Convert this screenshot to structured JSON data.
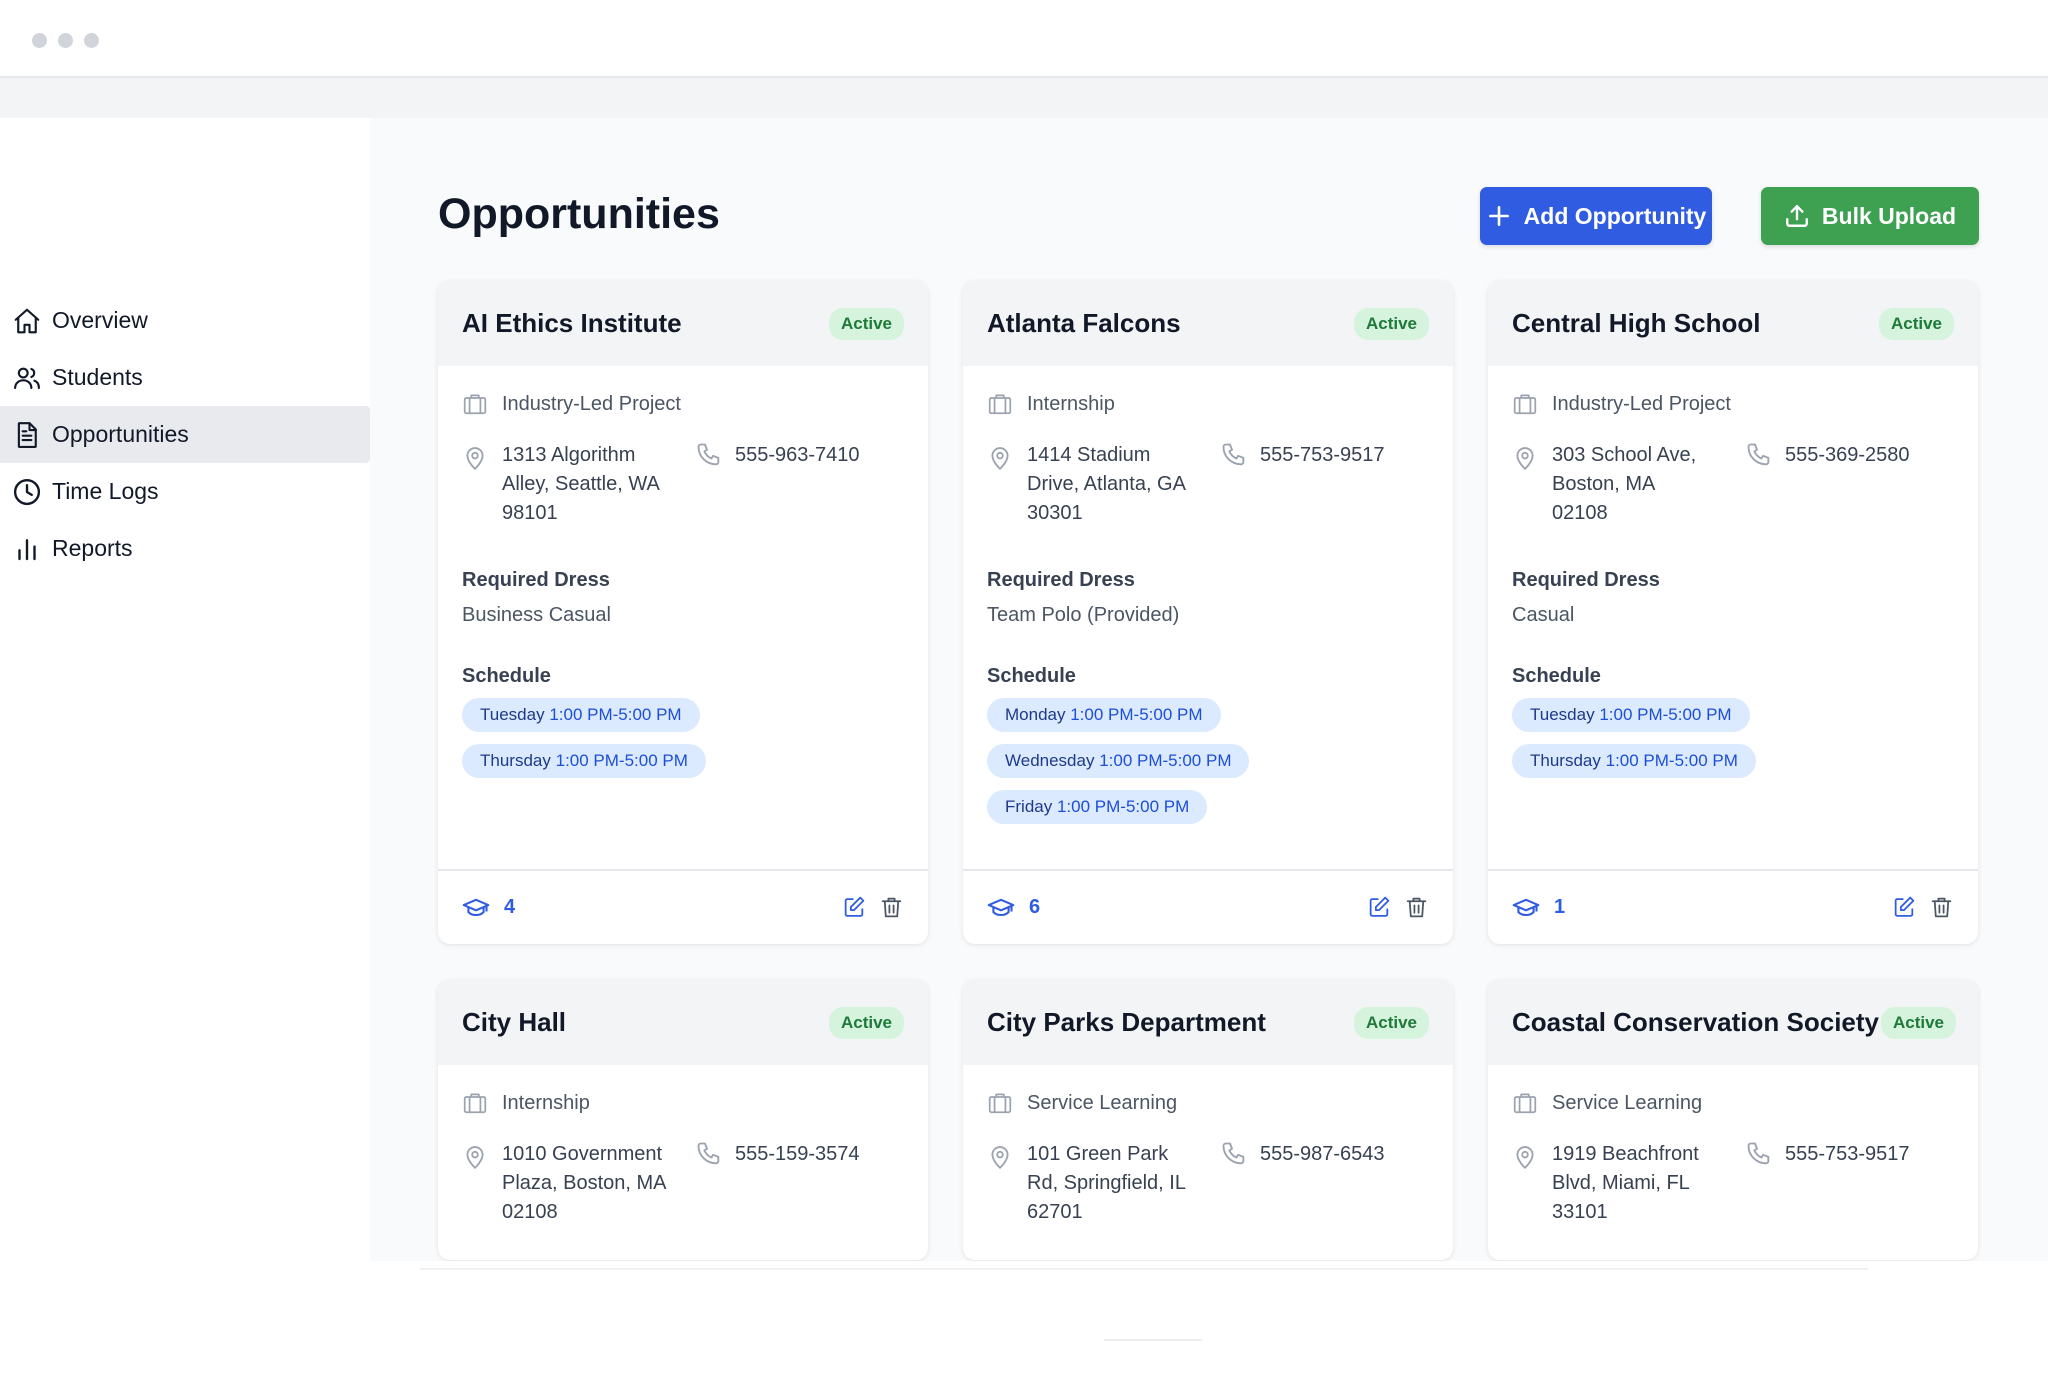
{
  "colors": {
    "primary": "#2f5ce0",
    "success": "#3ea051",
    "badge_bg": "#d5f3dd",
    "chip_bg": "#dbeafe",
    "sidebar_active": "#e9eaee"
  },
  "sidebar": {
    "items": [
      {
        "label": "Overview",
        "icon": "home-icon",
        "active": false
      },
      {
        "label": "Students",
        "icon": "users-icon",
        "active": false
      },
      {
        "label": "Opportunities",
        "icon": "document-icon",
        "active": true
      },
      {
        "label": "Time Logs",
        "icon": "clock-icon",
        "active": false
      },
      {
        "label": "Reports",
        "icon": "bar-chart-icon",
        "active": false
      }
    ]
  },
  "header": {
    "title": "Opportunities",
    "add_label": "Add Opportunity",
    "bulk_label": "Bulk Upload"
  },
  "labels": {
    "required_dress": "Required Dress",
    "schedule": "Schedule"
  },
  "cards": [
    {
      "name": "AI Ethics Institute",
      "status": "Active",
      "type": "Industry-Led Project",
      "address": [
        "1313 Algorithm",
        "Alley, Seattle, WA",
        "98101"
      ],
      "phone": "555-963-7410",
      "dress": "Business Casual",
      "schedule": [
        {
          "day": "Tuesday",
          "time": "1:00 PM-5:00 PM"
        },
        {
          "day": "Thursday",
          "time": "1:00 PM-5:00 PM"
        }
      ],
      "students": "4"
    },
    {
      "name": "Atlanta Falcons",
      "status": "Active",
      "type": "Internship",
      "address": [
        "1414 Stadium",
        "Drive, Atlanta, GA",
        "30301"
      ],
      "phone": "555-753-9517",
      "dress": "Team Polo (Provided)",
      "schedule": [
        {
          "day": "Monday",
          "time": "1:00 PM-5:00 PM"
        },
        {
          "day": "Wednesday",
          "time": "1:00 PM-5:00 PM"
        },
        {
          "day": "Friday",
          "time": "1:00 PM-5:00 PM"
        }
      ],
      "students": "6"
    },
    {
      "name": "Central High School",
      "status": "Active",
      "type": "Industry-Led Project",
      "address": [
        "303 School Ave,",
        "Boston, MA",
        "02108"
      ],
      "phone": "555-369-2580",
      "dress": "Casual",
      "schedule": [
        {
          "day": "Tuesday",
          "time": "1:00 PM-5:00 PM"
        },
        {
          "day": "Thursday",
          "time": "1:00 PM-5:00 PM"
        }
      ],
      "students": "1"
    },
    {
      "name": "City Hall",
      "status": "Active",
      "type": "Internship",
      "address": [
        "1010 Government",
        "Plaza, Boston, MA",
        "02108"
      ],
      "phone": "555-159-3574"
    },
    {
      "name": "City Parks Department",
      "status": "Active",
      "type": "Service Learning",
      "address": [
        "101 Green Park",
        "Rd, Springfield, IL",
        "62701"
      ],
      "phone": "555-987-6543"
    },
    {
      "name": "Coastal Conservation Society",
      "status": "Active",
      "type": "Service Learning",
      "address": [
        "1919 Beachfront",
        "Blvd, Miami, FL",
        "33101"
      ],
      "phone": "555-753-9517"
    }
  ]
}
